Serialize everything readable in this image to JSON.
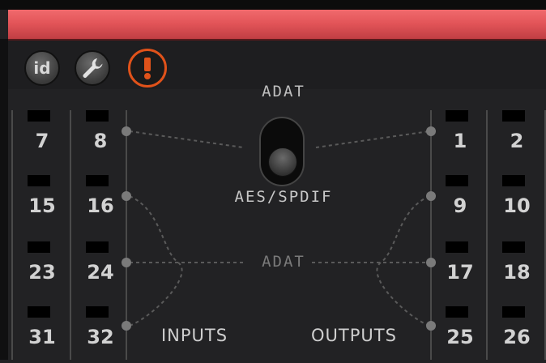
{
  "toolbar": {
    "id_label": "id",
    "icons": [
      "id-icon",
      "wrench-icon",
      "alert-icon"
    ],
    "accent": "#e0521a",
    "header_color": "#e35559"
  },
  "routing": {
    "switch_top_label": "ADAT",
    "switch_bottom_label": "AES/SPDIF",
    "middle_label": "ADAT",
    "inputs_label": "INPUTS",
    "outputs_label": "OUTPUTS",
    "switch_position": "AES/SPDIF"
  },
  "inputs": {
    "left_column": [
      "7",
      "15",
      "23",
      "31"
    ],
    "right_column": [
      "8",
      "16",
      "24",
      "32"
    ]
  },
  "outputs": {
    "left_column": [
      "1",
      "9",
      "17",
      "25"
    ],
    "right_column": [
      "2",
      "10",
      "18",
      "26"
    ]
  }
}
